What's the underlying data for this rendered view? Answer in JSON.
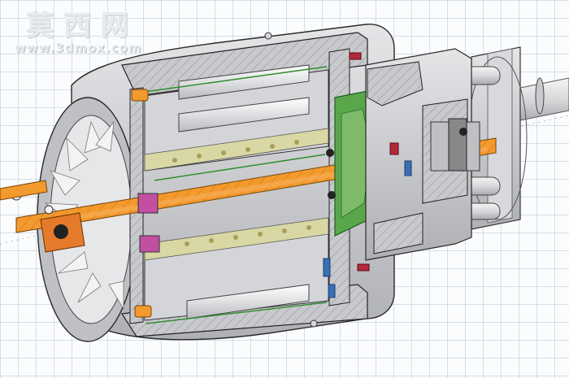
{
  "watermark": {
    "chinese_text": "莫西网",
    "url_text": "www.3dmox.com"
  },
  "model": {
    "name": "",
    "palette": {
      "housing": "#cfd0d3",
      "housing_dark": "#9a9ca1",
      "section_hatch": "#c7c8cb",
      "shaft": "#f39a2e",
      "shaft_light": "#f7b15c",
      "liner": "#d9d9a8",
      "wire_green": "#2b8c2b",
      "impeller_green": "#5aa64a",
      "bolt_blue": "#3a6fb5",
      "bearing_magenta": "#c24fa0",
      "red_part": "#b2293a",
      "outline": "#2a2a2a"
    }
  }
}
